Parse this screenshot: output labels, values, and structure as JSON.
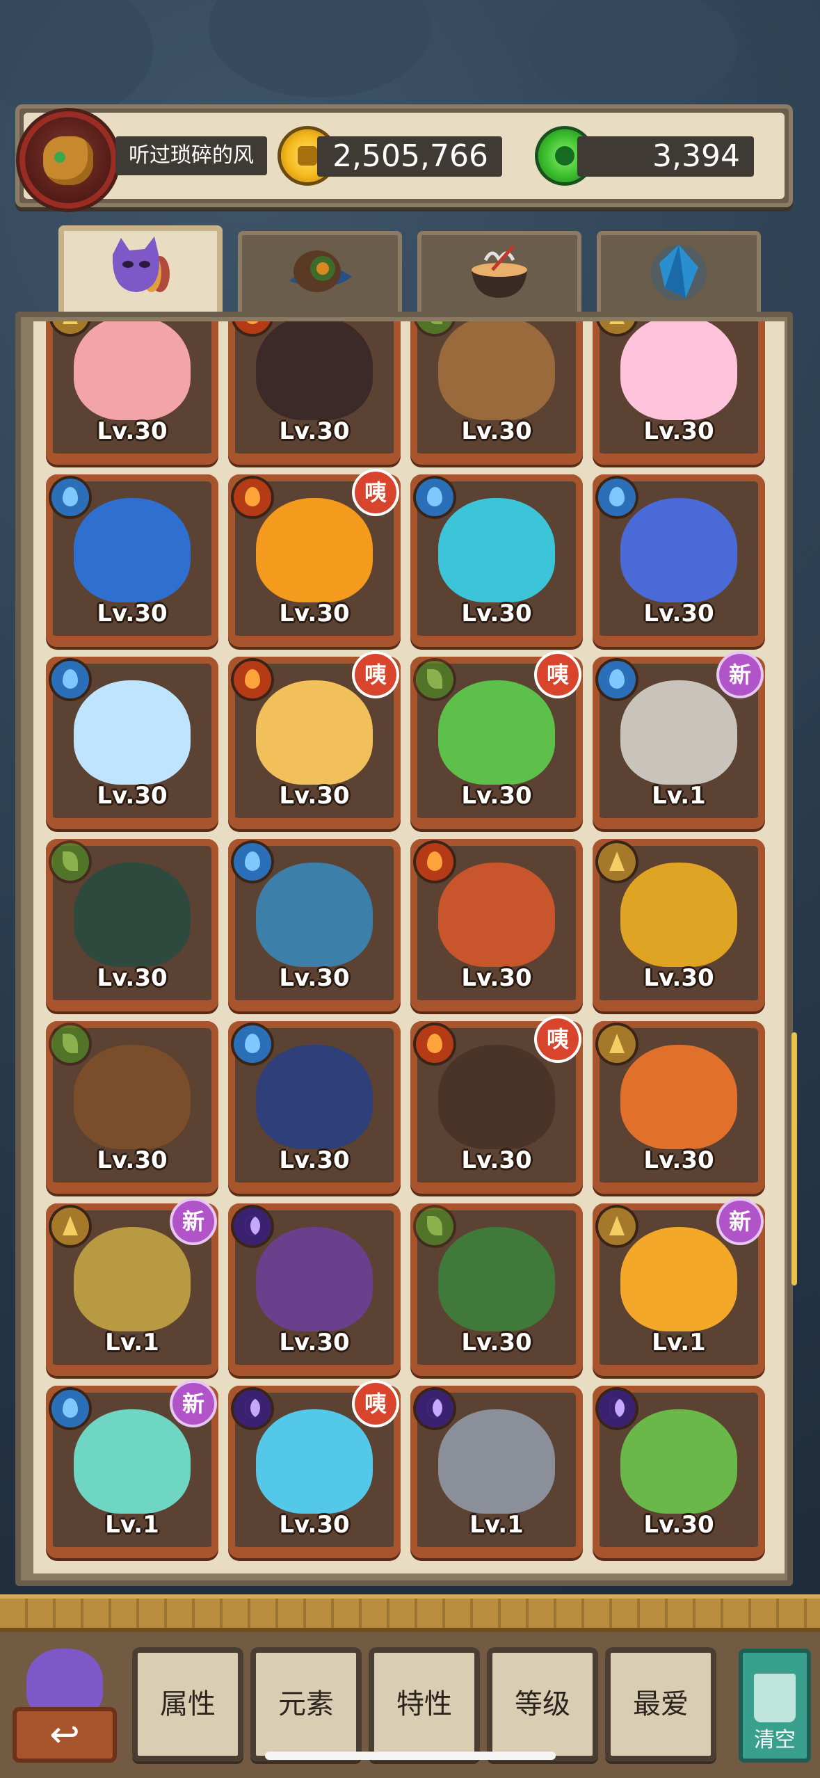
{
  "player": {
    "name": "听过琐碎的风",
    "gold": "2,505,766",
    "gems": "3,394"
  },
  "tabs": [
    {
      "name": "pets",
      "icon": "purple-monster-icon",
      "active": true
    },
    {
      "name": "items",
      "icon": "feather-hat-icon",
      "active": false
    },
    {
      "name": "food",
      "icon": "noodle-bowl-icon",
      "active": false
    },
    {
      "name": "crystal",
      "icon": "blue-crystal-icon",
      "active": false
    }
  ],
  "cards": [
    {
      "level": "Lv.30",
      "element": "earth",
      "badge": "",
      "art": "#f3a4a8"
    },
    {
      "level": "Lv.30",
      "element": "fire",
      "badge": "",
      "art": "#3b2a28"
    },
    {
      "level": "Lv.30",
      "element": "leaf",
      "badge": "",
      "art": "#9a6a3c"
    },
    {
      "level": "Lv.30",
      "element": "earth",
      "badge": "",
      "art": "#ffc4dc"
    },
    {
      "level": "Lv.30",
      "element": "water",
      "badge": "",
      "art": "#2f6fd0"
    },
    {
      "level": "Lv.30",
      "element": "fire",
      "badge": "咦",
      "art": "#f49a1c"
    },
    {
      "level": "Lv.30",
      "element": "water",
      "badge": "",
      "art": "#3cc5d8"
    },
    {
      "level": "Lv.30",
      "element": "water",
      "badge": "",
      "art": "#4a6ad8"
    },
    {
      "level": "Lv.30",
      "element": "water",
      "badge": "",
      "art": "#bfe4ff"
    },
    {
      "level": "Lv.30",
      "element": "fire",
      "badge": "咦",
      "art": "#f2c05a"
    },
    {
      "level": "Lv.30",
      "element": "leaf",
      "badge": "咦",
      "art": "#5cc04a"
    },
    {
      "level": "Lv.1",
      "element": "water",
      "badge": "新",
      "art": "#c9c4bb"
    },
    {
      "level": "Lv.30",
      "element": "leaf",
      "badge": "",
      "art": "#2e4a3e"
    },
    {
      "level": "Lv.30",
      "element": "water",
      "badge": "",
      "art": "#3c7fa8"
    },
    {
      "level": "Lv.30",
      "element": "fire",
      "badge": "",
      "art": "#c8552c"
    },
    {
      "level": "Lv.30",
      "element": "earth",
      "badge": "",
      "art": "#e0a424"
    },
    {
      "level": "Lv.30",
      "element": "leaf",
      "badge": "",
      "art": "#7a4e2a"
    },
    {
      "level": "Lv.30",
      "element": "water",
      "badge": "",
      "art": "#2f3f7a"
    },
    {
      "level": "Lv.30",
      "element": "fire",
      "badge": "咦",
      "art": "#4a3428"
    },
    {
      "level": "Lv.30",
      "element": "earth",
      "badge": "",
      "art": "#e0702a"
    },
    {
      "level": "Lv.1",
      "element": "earth",
      "badge": "新",
      "art": "#b89a42"
    },
    {
      "level": "Lv.30",
      "element": "moon",
      "badge": "",
      "art": "#6a3f8c"
    },
    {
      "level": "Lv.30",
      "element": "leaf",
      "badge": "",
      "art": "#3f7a3a"
    },
    {
      "level": "Lv.1",
      "element": "earth",
      "badge": "新",
      "art": "#f4a82a"
    },
    {
      "level": "Lv.1",
      "element": "water",
      "badge": "新",
      "art": "#6fd6c4"
    },
    {
      "level": "Lv.30",
      "element": "moon",
      "badge": "咦",
      "art": "#54c8e8"
    },
    {
      "level": "Lv.1",
      "element": "moon",
      "badge": "",
      "art": "#8a8f9a"
    },
    {
      "level": "Lv.30",
      "element": "moon",
      "badge": "",
      "art": "#6ab84a"
    }
  ],
  "filters": [
    "属性",
    "元素",
    "特性",
    "等级",
    "最爱"
  ],
  "clear_label": "清空",
  "colors": {
    "panel": "#e8dcc3",
    "card_frame": "#a8552e",
    "badge_heal": "#d9452c",
    "badge_new": "#b154c8"
  }
}
